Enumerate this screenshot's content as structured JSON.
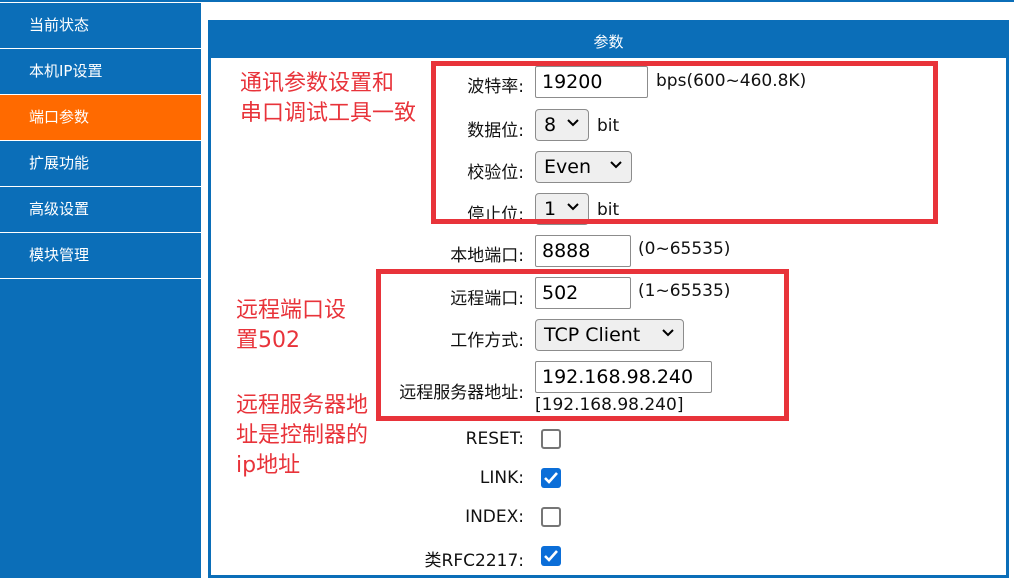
{
  "sidebar": {
    "items": [
      {
        "label": "当前状态",
        "active": false
      },
      {
        "label": "本机IP设置",
        "active": false
      },
      {
        "label": "端口参数",
        "active": true
      },
      {
        "label": "扩展功能",
        "active": false
      },
      {
        "label": "高级设置",
        "active": false
      },
      {
        "label": "模块管理",
        "active": false
      }
    ]
  },
  "panel": {
    "title": "参数"
  },
  "form": {
    "baud": {
      "label": "波特率:",
      "value": "19200",
      "unit": "bps(600~460.8K)"
    },
    "databits": {
      "label": "数据位:",
      "value": "8",
      "unit": "bit"
    },
    "parity": {
      "label": "校验位:",
      "value": "Even"
    },
    "stopbits": {
      "label": "停止位:",
      "value": "1",
      "unit": "bit"
    },
    "local_port": {
      "label": "本地端口:",
      "value": "8888",
      "range": "(0~65535)"
    },
    "remote_port": {
      "label": "远程端口:",
      "value": "502",
      "range": "(1~65535)"
    },
    "work_mode": {
      "label": "工作方式:",
      "value": "TCP Client"
    },
    "remote_server": {
      "label": "远程服务器地址:",
      "value": "192.168.98.240",
      "echo": "[192.168.98.240]"
    },
    "reset": {
      "label": "RESET:",
      "checked": false
    },
    "link": {
      "label": "LINK:",
      "checked": true
    },
    "index": {
      "label": "INDEX:",
      "checked": false
    },
    "rfc2217": {
      "label": "类RFC2217:",
      "checked": true
    }
  },
  "annotations": {
    "note1_line1": "通讯参数设置和",
    "note1_line2": "串口调试工具一致",
    "note2_line1": "远程端口设",
    "note2_line2": "置502",
    "note3_line1": "远程服务器地",
    "note3_line2": "址是控制器的",
    "note3_line3": "ip地址"
  },
  "colors": {
    "primary": "#0b6eb8",
    "active_nav": "#ff6a00",
    "annotation": "#e8333a",
    "checkbox": "#0b6ed8"
  }
}
